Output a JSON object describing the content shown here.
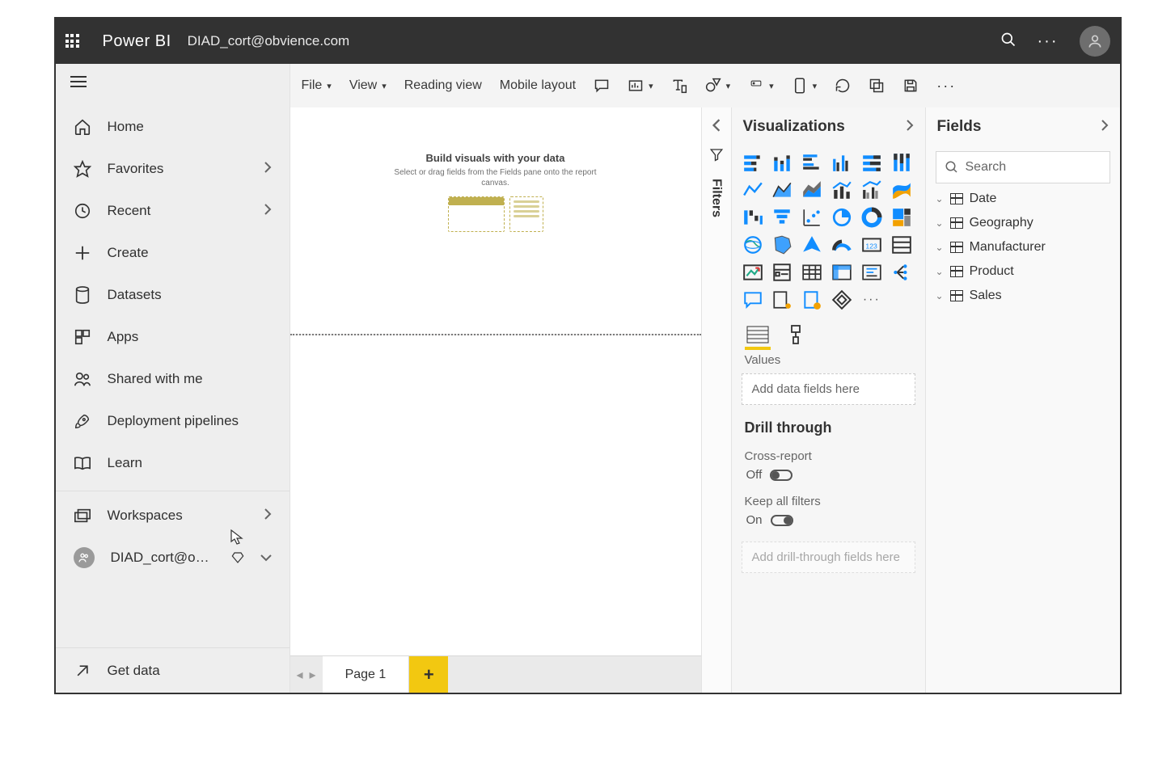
{
  "topbar": {
    "brand": "Power BI",
    "user_email": "DIAD_cort@obvience.com"
  },
  "left_nav": {
    "items": [
      {
        "label": "Home",
        "icon": "home"
      },
      {
        "label": "Favorites",
        "icon": "star",
        "expandable": true
      },
      {
        "label": "Recent",
        "icon": "clock",
        "expandable": true
      },
      {
        "label": "Create",
        "icon": "plus"
      },
      {
        "label": "Datasets",
        "icon": "database"
      },
      {
        "label": "Apps",
        "icon": "apps"
      },
      {
        "label": "Shared with me",
        "icon": "people"
      },
      {
        "label": "Deployment pipelines",
        "icon": "rocket"
      },
      {
        "label": "Learn",
        "icon": "book"
      }
    ],
    "workspaces_label": "Workspaces",
    "workspace_name": "DIAD_cort@obvi...",
    "get_data_label": "Get data"
  },
  "toolbar": {
    "file": "File",
    "view": "View",
    "reading_view": "Reading view",
    "mobile_layout": "Mobile layout"
  },
  "canvas": {
    "placeholder_title": "Build visuals with your data",
    "placeholder_sub": "Select or drag fields from the Fields pane onto the report canvas."
  },
  "page_tabs": {
    "page_label": "Page 1"
  },
  "filters": {
    "label": "Filters"
  },
  "visualizations": {
    "title": "Visualizations",
    "values_label": "Values",
    "values_placeholder": "Add data fields here",
    "drill_through": "Drill through",
    "cross_report_label": "Cross-report",
    "cross_report_value": "Off",
    "keep_all_filters_label": "Keep all filters",
    "keep_all_filters_value": "On",
    "drill_placeholder": "Add drill-through fields here"
  },
  "fields": {
    "title": "Fields",
    "search_placeholder": "Search",
    "tables": [
      "Date",
      "Geography",
      "Manufacturer",
      "Product",
      "Sales"
    ]
  }
}
